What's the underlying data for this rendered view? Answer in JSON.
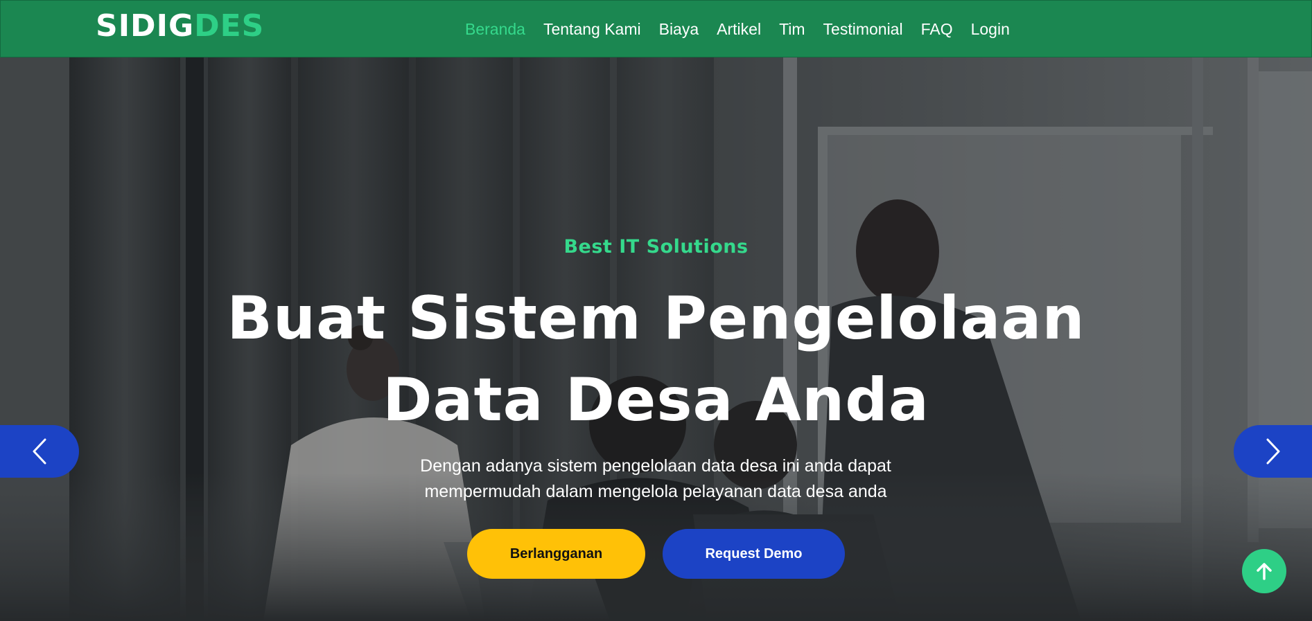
{
  "brand": {
    "part1": "SIDIG",
    "part2": "DES"
  },
  "nav": {
    "items": [
      {
        "label": "Beranda",
        "active": true
      },
      {
        "label": "Tentang Kami"
      },
      {
        "label": "Biaya"
      },
      {
        "label": "Artikel"
      },
      {
        "label": "Tim"
      },
      {
        "label": "Testimonial"
      },
      {
        "label": "FAQ"
      },
      {
        "label": "Login"
      }
    ]
  },
  "hero": {
    "kicker": "Best IT Solutions",
    "headline_line1": "Buat Sistem Pengelolaan",
    "headline_line2": "Data Desa Anda",
    "subtext_line1": "Dengan adanya sistem pengelolaan data desa ini anda dapat",
    "subtext_line2": "mempermudah dalam mengelola pelayanan data desa anda",
    "subscribe_label": "Berlangganan",
    "demo_label": "Request Demo"
  },
  "icons": {
    "prev": "chevron-left-icon",
    "next": "chevron-right-icon",
    "to_top": "arrow-up-icon"
  },
  "colors": {
    "navbar": "#1b8751",
    "accent_green": "#35d98c",
    "button_yellow": "#ffc107",
    "button_blue": "#1c43c5"
  }
}
